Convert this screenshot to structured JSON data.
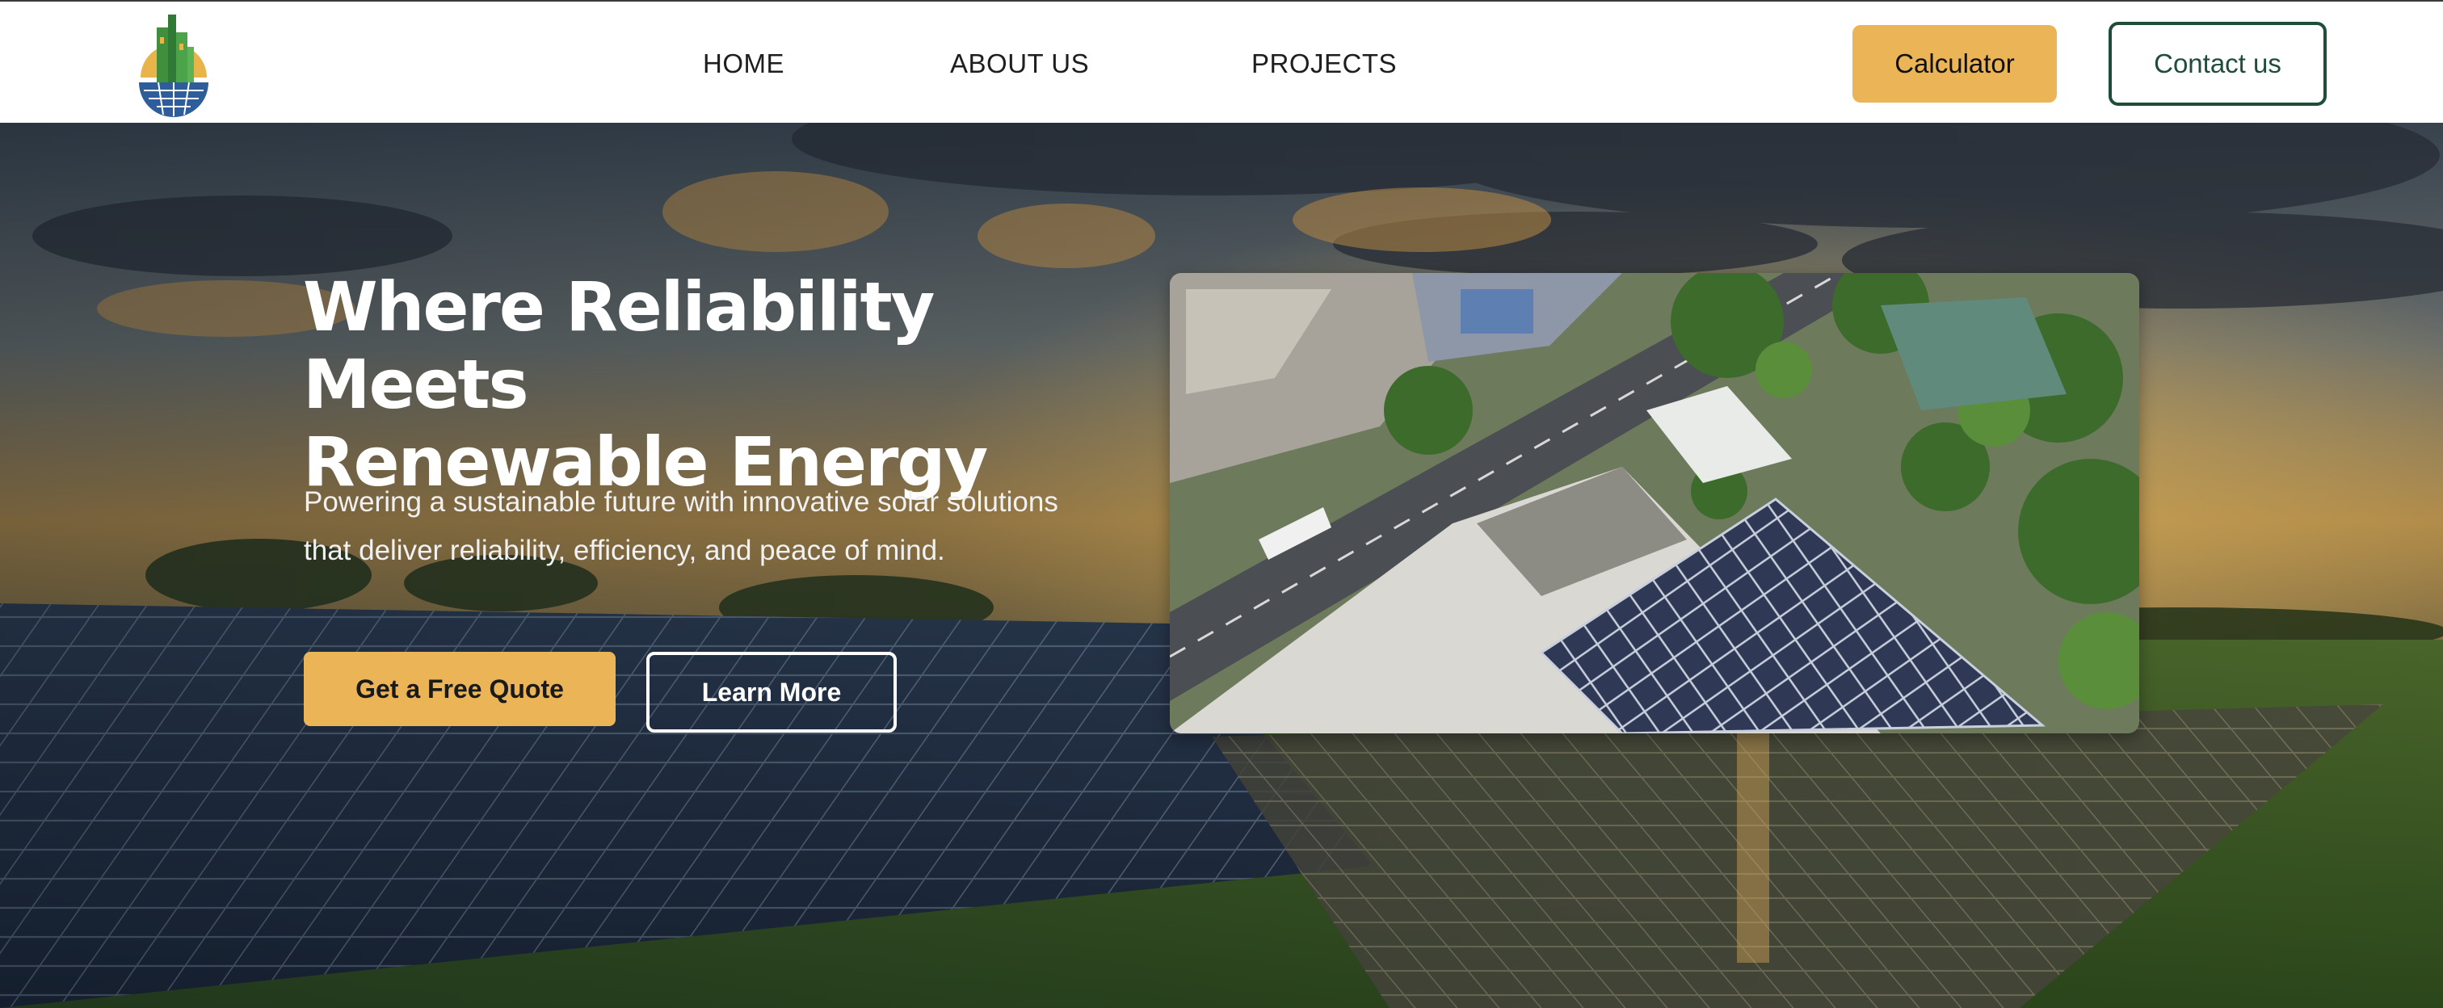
{
  "header": {
    "logo_icon": "solar-building-logo-icon",
    "nav": [
      {
        "label": "HOME"
      },
      {
        "label": "ABOUT US"
      },
      {
        "label": "PROJECTS"
      }
    ],
    "calculator_label": "Calculator",
    "contact_label": "Contact us"
  },
  "hero": {
    "title_line1": "Where Reliability Meets",
    "title_line2": "Renewable Energy",
    "subtitle_line1": "Powering a sustainable future with innovative solar solutions",
    "subtitle_line2": "that deliver reliability, efficiency, and peace of mind.",
    "primary_cta": "Get a Free Quote",
    "secondary_cta": "Learn More"
  },
  "colors": {
    "accent": "#ebb557",
    "brand_green": "#1f4d3a",
    "text_dark": "#1e1e1e",
    "white": "#ffffff"
  }
}
